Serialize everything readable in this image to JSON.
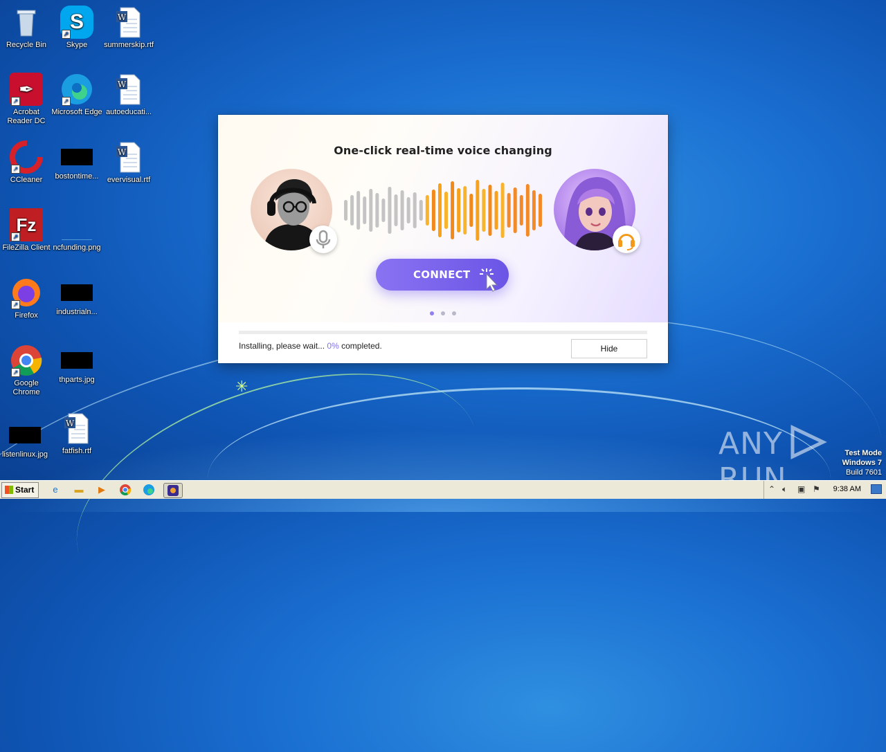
{
  "desktop": {
    "icons": [
      {
        "label": "Recycle Bin",
        "icon": "recycle-bin-icon"
      },
      {
        "label": "Skype",
        "icon": "skype-icon"
      },
      {
        "label": "summerskip.rtf",
        "icon": "word-document-icon"
      },
      {
        "label": "Acrobat Reader DC",
        "icon": "acrobat-icon"
      },
      {
        "label": "Microsoft Edge",
        "icon": "edge-icon"
      },
      {
        "label": "autoeducati...",
        "icon": "word-document-icon"
      },
      {
        "label": "CCleaner",
        "icon": "ccleaner-icon"
      },
      {
        "label": "bostontime...",
        "icon": "image-file-icon"
      },
      {
        "label": "evervisual.rtf",
        "icon": "word-document-icon"
      },
      {
        "label": "FileZilla Client",
        "icon": "filezilla-icon"
      },
      {
        "label": "ncfunding.png",
        "icon": "image-file-icon"
      },
      {
        "label": "Firefox",
        "icon": "firefox-icon"
      },
      {
        "label": "industrialn...",
        "icon": "image-file-icon"
      },
      {
        "label": "Google Chrome",
        "icon": "chrome-icon"
      },
      {
        "label": "thparts.jpg",
        "icon": "image-file-icon"
      },
      {
        "label": "listenlinux.jpg",
        "icon": "image-file-icon"
      },
      {
        "label": "fatfish.rtf",
        "icon": "word-document-icon"
      }
    ]
  },
  "installer": {
    "headline": "One-click real-time voice changing",
    "connect_label": "CONNECT",
    "carousel_dots": 3,
    "active_dot": 0,
    "progress_percent": 0,
    "status_prefix": "Installing, please wait...",
    "status_percent": "0%",
    "status_suffix": "completed.",
    "hide_label": "Hide",
    "accent_color": "#7a6df0"
  },
  "watermark": {
    "text": "ANY RUN",
    "test_mode": "Test Mode",
    "os": "Windows 7",
    "build": "Build 7601"
  },
  "taskbar": {
    "start_label": "Start",
    "clock": "9:38 AM",
    "pinned": [
      "ie-icon",
      "explorer-icon",
      "media-player-icon",
      "chrome-icon",
      "edge-icon",
      "installer-app-icon"
    ]
  }
}
